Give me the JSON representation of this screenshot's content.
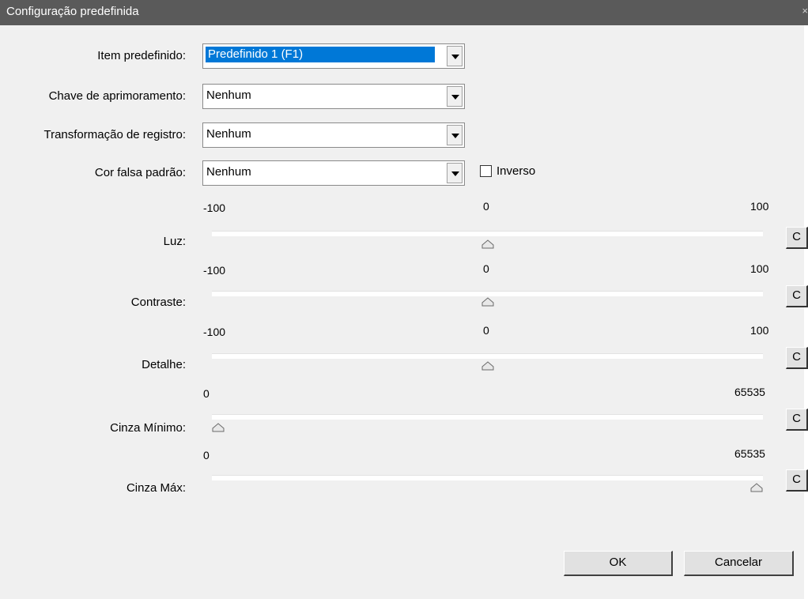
{
  "window": {
    "title": "Configuração predefinida",
    "close_glyph": "×"
  },
  "fields": {
    "preset_label": "Item predefinido:",
    "preset_value": "Predefinido 1 (F1)",
    "enhance_label": "Chave de aprimoramento:",
    "enhance_value": "Nenhum",
    "transform_label": "Transformação de registro:",
    "transform_value": "Nenhum",
    "falsecolor_label": "Cor falsa padrão:",
    "falsecolor_value": "Nenhum",
    "inverse_label": "Inverso",
    "inverse_checked": false
  },
  "sliders": [
    {
      "label": "Luz:",
      "min": "-100",
      "mid": "0",
      "max": "100",
      "value": 0,
      "reset": "C"
    },
    {
      "label": "Contraste:",
      "min": "-100",
      "mid": "0",
      "max": "100",
      "value": 0,
      "reset": "C"
    },
    {
      "label": "Detalhe:",
      "min": "-100",
      "mid": "0",
      "max": "100",
      "value": 0,
      "reset": "C"
    },
    {
      "label": "Cinza Mínimo:",
      "min": "0",
      "max": "65535",
      "value": 0,
      "reset": "C"
    },
    {
      "label": "Cinza Máx:",
      "min": "0",
      "max": "65535",
      "value": 65535,
      "reset": "C"
    }
  ],
  "buttons": {
    "ok": "OK",
    "cancel": "Cancelar"
  },
  "colors": {
    "titlebar": "#5a5a5a",
    "selection": "#0078d7",
    "dialog_bg": "#f0f0f0"
  }
}
